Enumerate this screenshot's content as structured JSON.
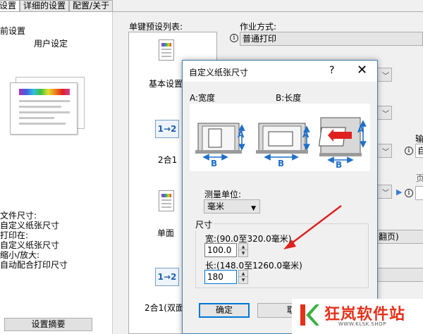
{
  "tabs": [
    "设置",
    "详细的设置",
    "配置/关于"
  ],
  "left_panel": {
    "title": "前设置",
    "user_setting": "用户设定",
    "summary": [
      "文件尺寸:",
      "自定义纸张尺寸",
      "打印在:",
      "自定义纸张尺寸",
      "缩小/放大:",
      "自动配合打印尺寸"
    ],
    "summary_button": "设置摘要"
  },
  "presets": {
    "label": "单键预设列表:",
    "items": [
      {
        "label": "基本设置",
        "icon": "document-icon"
      },
      {
        "label": "2合1",
        "icon": "two-in-one-icon",
        "icon_text": "1→2"
      },
      {
        "label": "单面",
        "icon": "document-icon"
      },
      {
        "label": "2合1(双面",
        "icon": "two-in-one-icon",
        "icon_text": "1→2"
      }
    ]
  },
  "job": {
    "label": "作业方式:",
    "value": "普通打印",
    "partial_texts": [
      "输",
      "自",
      "页",
      "翻页)"
    ]
  },
  "dialog": {
    "title": "自定义纸张尺寸",
    "help": "?",
    "close": "✕",
    "width_label": "A:宽度",
    "length_label": "B:长度",
    "diagram_letters": {
      "a": "A",
      "b": "B"
    },
    "unit_label": "测量单位:",
    "unit_value": "毫米",
    "size_group": "尺寸",
    "width_range": "宽:(90.0至320.0毫米)",
    "width_value": "100.0",
    "length_range": "长:(148.0至1260.0毫米)",
    "length_value": "180",
    "ok": "确定",
    "cancel": "取"
  },
  "logo": {
    "main": "狂岚软件站",
    "url": "WWW.KLSK.SHOP"
  },
  "colors": {
    "accent": "#0078d7",
    "annotation": "#e02020",
    "logo_red": "#e6301a"
  }
}
